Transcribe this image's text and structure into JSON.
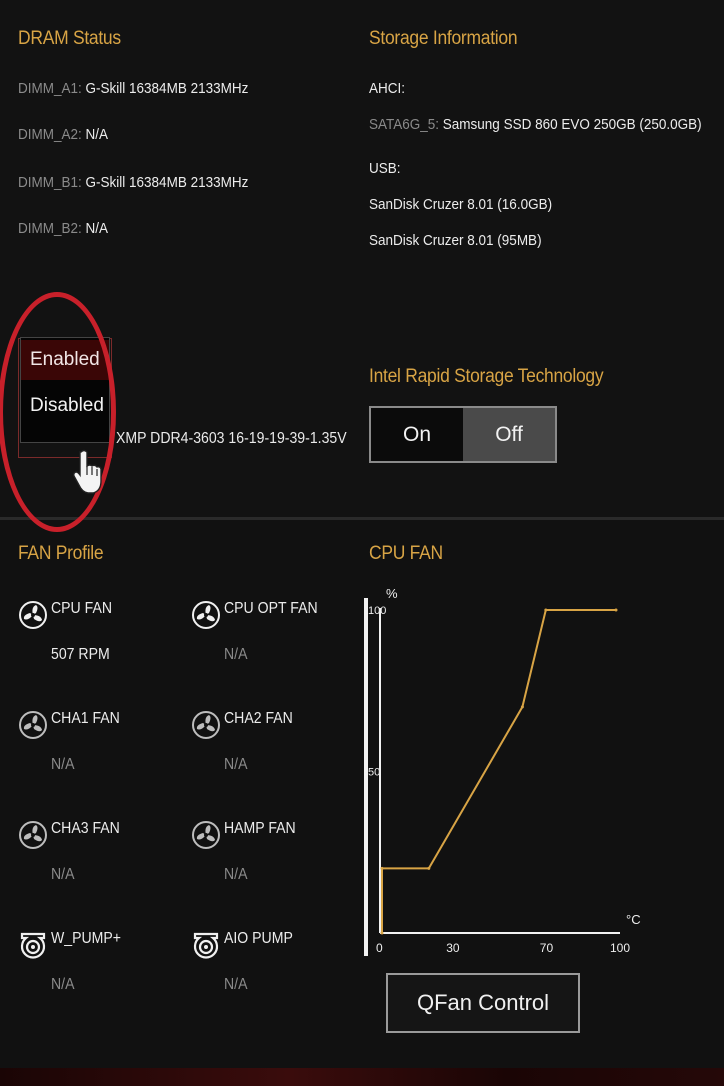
{
  "dram": {
    "title": "DRAM Status",
    "slots": [
      {
        "label": "DIMM_A1:",
        "value": "G-Skill 16384MB 2133MHz"
      },
      {
        "label": "DIMM_A2:",
        "value": "N/A"
      },
      {
        "label": "DIMM_B1:",
        "value": "G-Skill 16384MB 2133MHz"
      },
      {
        "label": "DIMM_B2:",
        "value": "N/A"
      }
    ]
  },
  "xmp": {
    "options": [
      "Enabled",
      "Disabled"
    ],
    "selected": "Enabled",
    "field_value": "Enabled",
    "profile_text": "XMP DDR4-3603 16-19-19-39-1.35V"
  },
  "storage": {
    "title": "Storage Information",
    "ahci_label": "AHCI:",
    "ahci_port": "SATA6G_5:",
    "ahci_device": "Samsung SSD 860 EVO 250GB (250.0GB)",
    "usb_label": "USB:",
    "usb_devices": [
      "SanDisk Cruzer 8.01 (16.0GB)",
      "SanDisk Cruzer 8.01 (95MB)"
    ]
  },
  "rst": {
    "title": "Intel Rapid Storage Technology",
    "on_label": "On",
    "off_label": "Off",
    "state": "Off"
  },
  "fan_profile": {
    "title": "FAN Profile",
    "fans": [
      {
        "name": "CPU FAN",
        "value": "507 RPM",
        "icon": "fan-icon"
      },
      {
        "name": "CPU OPT FAN",
        "value": "N/A",
        "icon": "fan-icon"
      },
      {
        "name": "CHA1 FAN",
        "value": "N/A",
        "icon": "fan-icon"
      },
      {
        "name": "CHA2 FAN",
        "value": "N/A",
        "icon": "fan-icon"
      },
      {
        "name": "CHA3 FAN",
        "value": "N/A",
        "icon": "fan-icon"
      },
      {
        "name": "HAMP FAN",
        "value": "N/A",
        "icon": "fan-icon"
      },
      {
        "name": "W_PUMP+",
        "value": "N/A",
        "icon": "pump-icon"
      },
      {
        "name": "AIO PUMP",
        "value": "N/A",
        "icon": "pump-icon"
      }
    ]
  },
  "cpu_fan_chart": {
    "title": "CPU FAN",
    "button_label": "QFan Control"
  },
  "chart_data": {
    "type": "line",
    "title": "CPU FAN",
    "xlabel": "°C",
    "ylabel": "%",
    "x_ticks": [
      "0",
      "30",
      "70",
      "100"
    ],
    "y_ticks": [
      "50",
      "100"
    ],
    "xlim": [
      0,
      100
    ],
    "ylim": [
      0,
      100
    ],
    "x": [
      0,
      0,
      20,
      60,
      70,
      100
    ],
    "y": [
      0,
      20,
      20,
      70,
      100,
      100
    ],
    "line_color": "#d8a445"
  },
  "colors": {
    "accent": "#d8a445",
    "highlight_ring": "#c8202a"
  }
}
